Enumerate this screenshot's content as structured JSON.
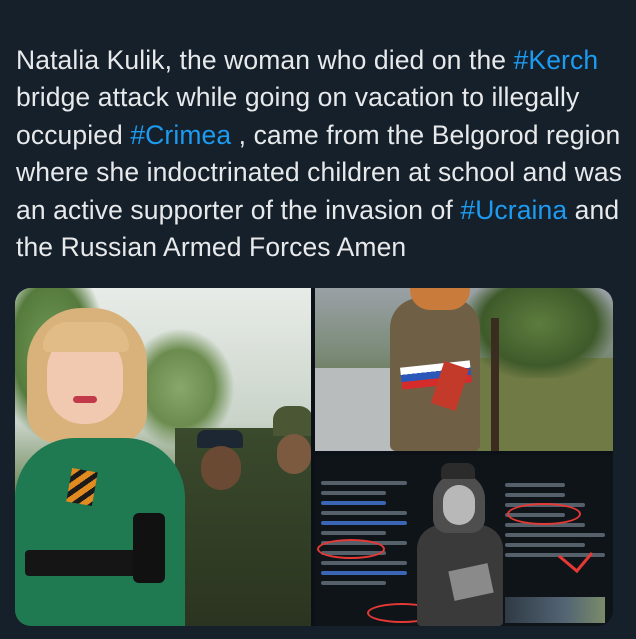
{
  "tweet": {
    "segments": [
      {
        "text": "Natalia Kulik, the woman who died on the ",
        "hashtag": false
      },
      {
        "text": "#Kerch",
        "hashtag": true
      },
      {
        "text": " bridge attack while going on vacation to illegally occupied ",
        "hashtag": false
      },
      {
        "text": "#Crimea",
        "hashtag": true
      },
      {
        "text": " , came from the Belgorod region where she indoctrinated children at school and was an active supporter of the invasion of ",
        "hashtag": false
      },
      {
        "text": "#Ucraina",
        "hashtag": true
      },
      {
        "text": " and the Russian Armed Forces Amen",
        "hashtag": false
      }
    ],
    "hashtag_color": "#1d9bf0",
    "text_color": "#e7e9ea",
    "background_color": "#15202b"
  },
  "media": {
    "count": 3
  }
}
